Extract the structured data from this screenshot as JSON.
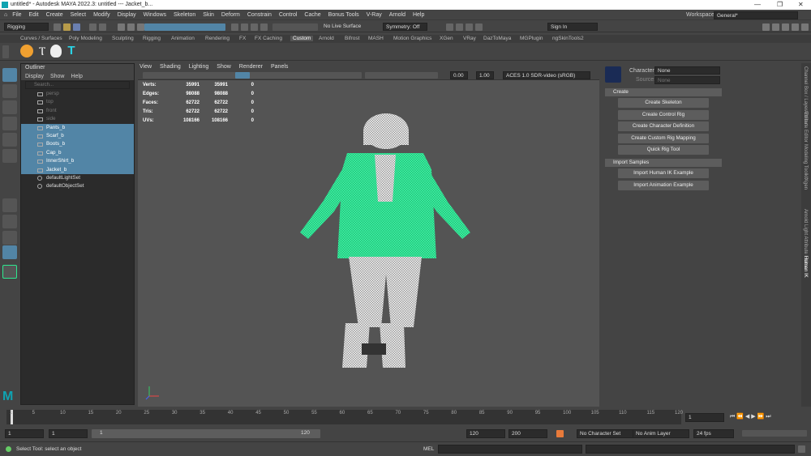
{
  "window": {
    "title": "untitled* - Autodesk MAYA 2022.3: untitled   ---   Jacket_b..."
  },
  "menubar": {
    "items": [
      "File",
      "Edit",
      "Create",
      "Select",
      "Modify",
      "Display",
      "Windows",
      "Skeleton",
      "Skin",
      "Deform",
      "Constrain",
      "Control",
      "Cache",
      "Bonus Tools",
      "V-Ray",
      "Arnold",
      "Help"
    ],
    "workspace_label": "Workspace:",
    "workspace_value": "General*"
  },
  "statusline": {
    "menuset": "Rigging",
    "live_surface": "No Live Surface",
    "symmetry": "Symmetry: Off",
    "sign_in": "Sign In"
  },
  "shelf": {
    "tabs": [
      "Curves / Surfaces",
      "Poly Modeling",
      "Sculpting",
      "Rigging",
      "Animation",
      "Rendering",
      "FX",
      "FX Caching",
      "Custom",
      "Arnold",
      "Bifrost",
      "MASH",
      "Motion Graphics",
      "XGen",
      "VRay",
      "DazToMaya",
      "MGPlugin",
      "ngSkinTools2"
    ],
    "active_tab": "Custom"
  },
  "outliner": {
    "title": "Outliner",
    "menu": [
      "Display",
      "Show",
      "Help"
    ],
    "search_placeholder": "Search...",
    "cameras": [
      "persp",
      "top",
      "front",
      "side"
    ],
    "selected": [
      "Pants_b",
      "Scarf_b",
      "Boots_b",
      "Cap_b",
      "InnerShirt_b",
      "Jacket_b"
    ],
    "sets": [
      "defaultLightSet",
      "defaultObjectSet"
    ]
  },
  "viewport": {
    "menu": [
      "View",
      "Shading",
      "Lighting",
      "Show",
      "Renderer",
      "Panels"
    ],
    "exposure": "0.00",
    "gamma": "1.00",
    "color_space": "ACES 1.0 SDR-video (sRGB)",
    "hud": [
      {
        "label": "Verts:",
        "a": "35991",
        "b": "35991",
        "c": "0"
      },
      {
        "label": "Edges:",
        "a": "98088",
        "b": "98088",
        "c": "0"
      },
      {
        "label": "Faces:",
        "a": "62722",
        "b": "62722",
        "c": "0"
      },
      {
        "label": "Tris:",
        "a": "62722",
        "b": "62722",
        "c": "0"
      },
      {
        "label": "UVs:",
        "a": "108166",
        "b": "108166",
        "c": "0"
      }
    ],
    "accent_jacket": "#2ee88f"
  },
  "humanik": {
    "character_label": "Character:",
    "character_value": "None",
    "source_label": "Source:",
    "source_value": "None",
    "create_section": "Create",
    "create_buttons": [
      "Create Skeleton",
      "Create Control Rig",
      "Create Character Definition",
      "Create Custom Rig Mapping",
      "Quick Rig Tool"
    ],
    "import_section": "Import Samples",
    "import_buttons": [
      "Import Human IK Example",
      "Import Animation Example"
    ]
  },
  "right_tabs": [
    "Channel Box / Layer Editor",
    "Attribute Editor",
    "Modeling Toolkit",
    "Xgen",
    "Arnold Light Attribute Editor",
    "Human IK"
  ],
  "timeline": {
    "ticks": [
      "1",
      "5",
      "10",
      "15",
      "20",
      "25",
      "30",
      "35",
      "40",
      "45",
      "50",
      "55",
      "60",
      "65",
      "70",
      "75",
      "80",
      "85",
      "90",
      "95",
      "100",
      "105",
      "110",
      "115",
      "120"
    ],
    "current_frame": "1"
  },
  "range": {
    "start": "1",
    "inner_start": "1",
    "slider_start": "1",
    "slider_end": "120",
    "end": "120",
    "anim_end": "200",
    "character_set": "No Character Set",
    "anim_layer": "No Anim Layer",
    "fps": "24 fps"
  },
  "command": {
    "help_text": "Select Tool: select an object",
    "lang": "MEL"
  }
}
